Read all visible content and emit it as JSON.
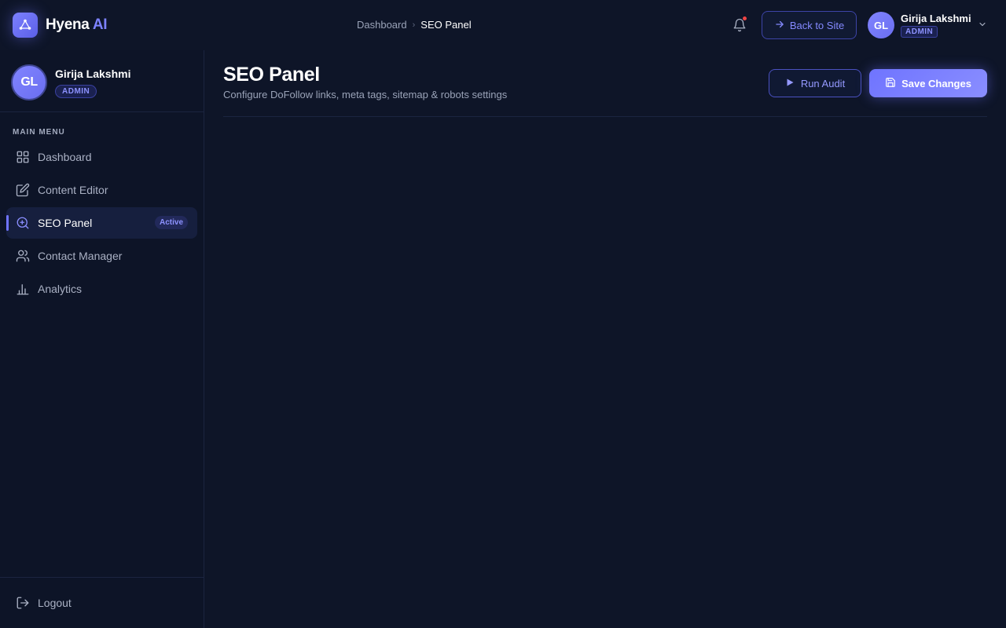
{
  "brand": {
    "name": "Hyena",
    "accent": "AI",
    "logo_icon": "network-nodes-icon"
  },
  "breadcrumb": {
    "parent": "Dashboard",
    "current": "SEO Panel"
  },
  "header": {
    "notifications_icon": "bell-icon",
    "back_to_site_label": "Back to Site",
    "user": {
      "initials": "GL",
      "name": "Girija Lakshmi",
      "role": "ADMIN"
    }
  },
  "sidebar": {
    "profile": {
      "initials": "GL",
      "name": "Girija Lakshmi",
      "role": "ADMIN"
    },
    "menu_title": "MAIN MENU",
    "items": [
      {
        "label": "Dashboard",
        "icon": "grid-icon"
      },
      {
        "label": "Content Editor",
        "icon": "edit-icon"
      },
      {
        "label": "SEO Panel",
        "icon": "search-plus-icon",
        "active": true,
        "tag": "Active"
      },
      {
        "label": "Contact Manager",
        "icon": "users-icon"
      },
      {
        "label": "Analytics",
        "icon": "bar-chart-icon"
      }
    ],
    "logout_label": "Logout"
  },
  "main": {
    "title": "SEO Panel",
    "subtitle": "Configure DoFollow links, meta tags, sitemap & robots settings",
    "run_audit_label": "Run Audit",
    "save_label": "Save Changes"
  },
  "colors": {
    "background": "#0e1528",
    "accent": "#6f74ff",
    "notification_dot": "#ef4444"
  }
}
